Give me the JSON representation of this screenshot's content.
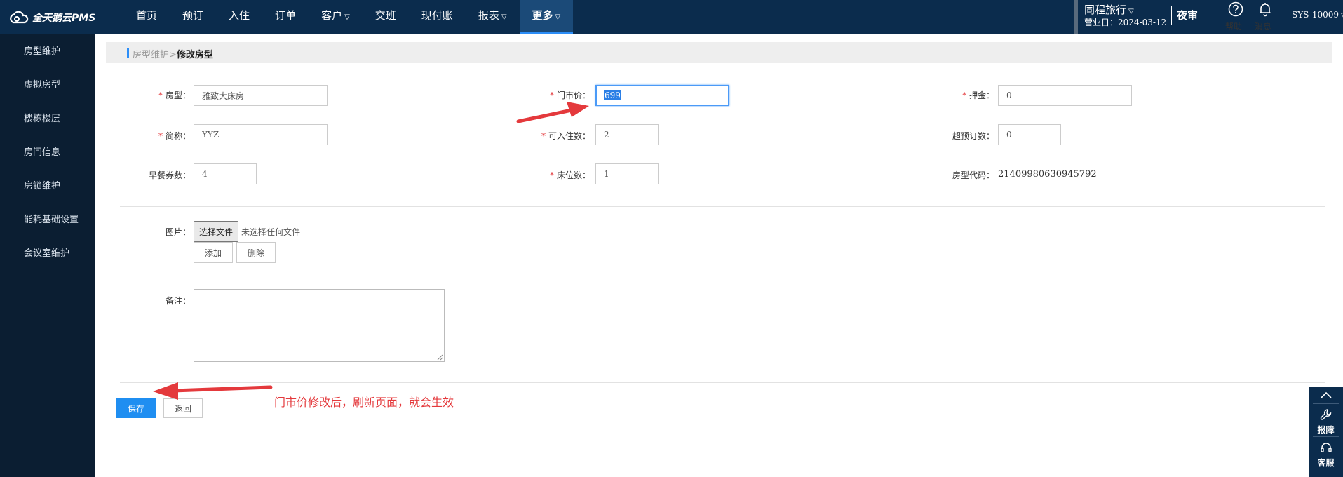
{
  "app": {
    "logo_text": "全天鹅云PMS"
  },
  "nav": {
    "items": [
      {
        "label": "首页",
        "caret": ""
      },
      {
        "label": "预订",
        "caret": ""
      },
      {
        "label": "入住",
        "caret": ""
      },
      {
        "label": "订单",
        "caret": ""
      },
      {
        "label": "客户",
        "caret": "▽"
      },
      {
        "label": "交班",
        "caret": ""
      },
      {
        "label": "现付账",
        "caret": ""
      },
      {
        "label": "报表",
        "caret": "▽"
      },
      {
        "label": "更多",
        "caret": "▽"
      }
    ],
    "active_index": 8
  },
  "header": {
    "hotel_name": "同程旅行",
    "hotel_caret": "▽",
    "business_date": "营业日：2024-03-12",
    "night_audit": "夜审",
    "help": "帮助",
    "messages": "消息",
    "user": "SYS-10009",
    "user_caret": "▽"
  },
  "sidebar": {
    "items": [
      "房型维护",
      "虚拟房型",
      "楼栋楼层",
      "房间信息",
      "房锁维护",
      "能耗基础设置",
      "会议室维护"
    ]
  },
  "breadcrumb": {
    "parent": "房型维护",
    "separator": ">",
    "current": "修改房型"
  },
  "form": {
    "required_mark": "*",
    "room_type": {
      "label": "房型：",
      "value": "雅致大床房"
    },
    "rack_rate": {
      "label": "门市价：",
      "value": "699"
    },
    "deposit": {
      "label": "押金：",
      "value": "0"
    },
    "short_name": {
      "label": "简称：",
      "value": "YYZ"
    },
    "max_guests": {
      "label": "可入住数：",
      "value": "2"
    },
    "overbooking": {
      "label": "超预订数：",
      "value": "0"
    },
    "breakfast": {
      "label": "早餐券数：",
      "value": "4"
    },
    "beds": {
      "label": "床位数：",
      "value": "1"
    },
    "room_code": {
      "label": "房型代码：",
      "value": "21409980630945792"
    },
    "image": {
      "label": "图片：",
      "choose_file": "选择文件",
      "no_file": "未选择任何文件",
      "add": "添加",
      "delete": "删除"
    },
    "remark": {
      "label": "备注：",
      "value": ""
    }
  },
  "actions": {
    "save": "保存",
    "back": "返回"
  },
  "annotation": {
    "text": "门市价修改后，刷新页面，就会生效",
    "color": "#e4393c"
  },
  "float_panel": {
    "report": "报障",
    "service": "客服"
  },
  "colors": {
    "topbar": "#0b2c4d",
    "sidebar": "#0b1e32",
    "primary": "#1f8ef1",
    "required": "#e4393c"
  }
}
